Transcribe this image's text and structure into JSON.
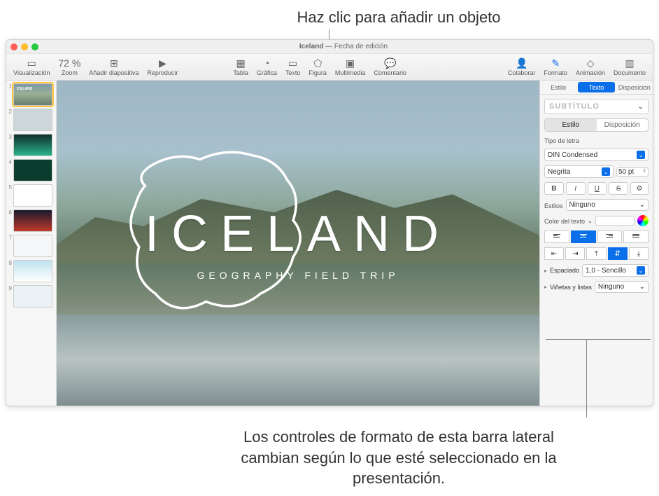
{
  "annotations": {
    "top": "Haz clic para añadir un objeto",
    "bottom": "Los controles de formato de esta barra lateral cambian según lo que esté seleccionado en la presentación."
  },
  "window": {
    "title": "Iceland",
    "title_suffix": " — Fecha de edición"
  },
  "toolbar": {
    "view": "Visualización",
    "zoom": "Zoom",
    "zoom_value": "72 %",
    "add_slide": "Añadir diapositiva",
    "play": "Reproducir",
    "table": "Tabla",
    "chart": "Gráfica",
    "text": "Texto",
    "shape": "Figura",
    "media": "Multimedia",
    "comment": "Comentario",
    "collaborate": "Colaborar",
    "format": "Formato",
    "animate": "Animación",
    "document": "Documento"
  },
  "slides": [
    {
      "n": "1"
    },
    {
      "n": "2"
    },
    {
      "n": "3"
    },
    {
      "n": "4"
    },
    {
      "n": "5"
    },
    {
      "n": "6"
    },
    {
      "n": "7"
    },
    {
      "n": "8"
    },
    {
      "n": "9"
    }
  ],
  "canvas": {
    "title": "ICELAND",
    "subtitle": "GEOGRAPHY FIELD TRIP"
  },
  "inspector": {
    "tabs": {
      "style": "Estilo",
      "text": "Texto",
      "arrange": "Disposición"
    },
    "paragraph_style": "Subtítulo",
    "subtabs": {
      "style": "Estilo",
      "layout": "Disposición"
    },
    "font_section": "Tipo de letra",
    "font_family": "DIN Condensed",
    "font_weight": "Negrita",
    "font_size": "50 pt",
    "bold": "B",
    "italic": "I",
    "underline": "U",
    "strike": "S",
    "char_styles_label": "Estilos",
    "char_styles_value": "Ninguno",
    "text_color_label": "Color del texto",
    "spacing_label": "Espaciado",
    "spacing_value": "1,0 - Sencillo",
    "bullets_label": "Viñetas y listas",
    "bullets_value": "Ninguno",
    "gear": "⚙"
  }
}
